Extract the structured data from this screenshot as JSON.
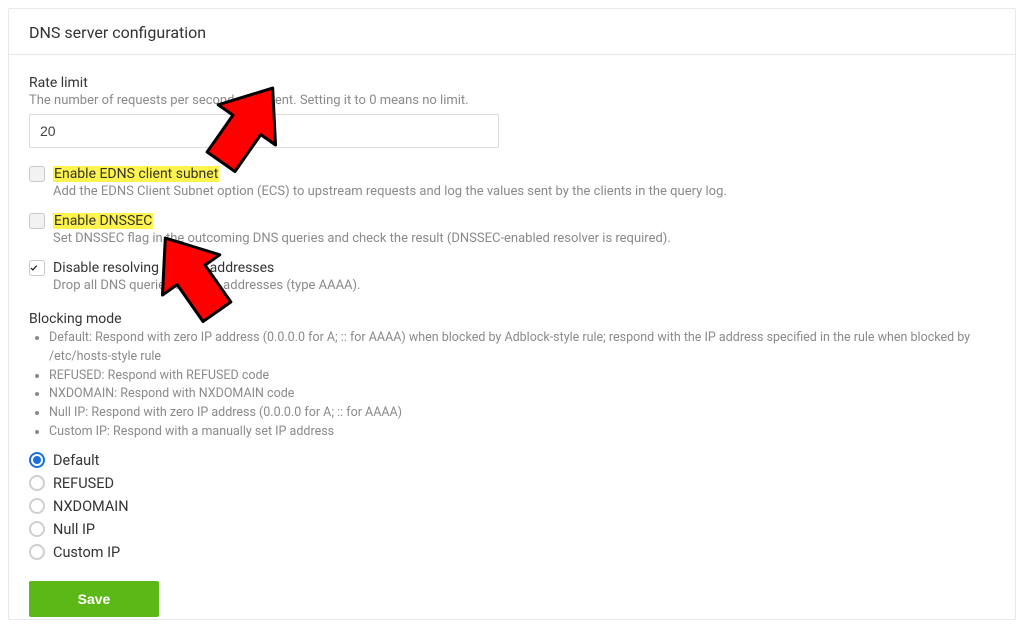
{
  "title": "DNS server configuration",
  "rate_limit": {
    "label": "Rate limit",
    "desc_before": "The number of requests per second allo",
    "desc_after": " client. Setting it to 0 means no limit.",
    "value": "20"
  },
  "checkboxes": {
    "edns": {
      "label": "Enable EDNS client subnet",
      "desc": "Add the EDNS Client Subnet option (ECS) to upstream requests and log the values sent by the clients in the query log.",
      "checked": false,
      "highlight": true
    },
    "dnssec": {
      "label": "Enable DNSSEC",
      "desc": "Set DNSSEC flag in the outcoming DNS queries and check the result (DNSSEC-enabled resolver is required).",
      "checked": false,
      "highlight": true
    },
    "disable_ipv6": {
      "label": "Disable resolving of IPv6 addresses",
      "desc": "Drop all DNS queries for IPv6 addresses (type AAAA).",
      "checked": true,
      "highlight": false
    }
  },
  "blocking": {
    "label": "Blocking mode",
    "descriptions": [
      "Default: Respond with zero IP address (0.0.0.0 for A; :: for AAAA) when blocked by Adblock-style rule; respond with the IP address specified in the rule when blocked by /etc/hosts-style rule",
      "REFUSED: Respond with REFUSED code",
      "NXDOMAIN: Respond with NXDOMAIN code",
      "Null IP: Respond with zero IP address (0.0.0.0 for A; :: for AAAA)",
      "Custom IP: Respond with a manually set IP address"
    ],
    "options": [
      {
        "label": "Default",
        "selected": true
      },
      {
        "label": "REFUSED",
        "selected": false
      },
      {
        "label": "NXDOMAIN",
        "selected": false
      },
      {
        "label": "Null IP",
        "selected": false
      },
      {
        "label": "Custom IP",
        "selected": false
      }
    ]
  },
  "save_label": "Save"
}
